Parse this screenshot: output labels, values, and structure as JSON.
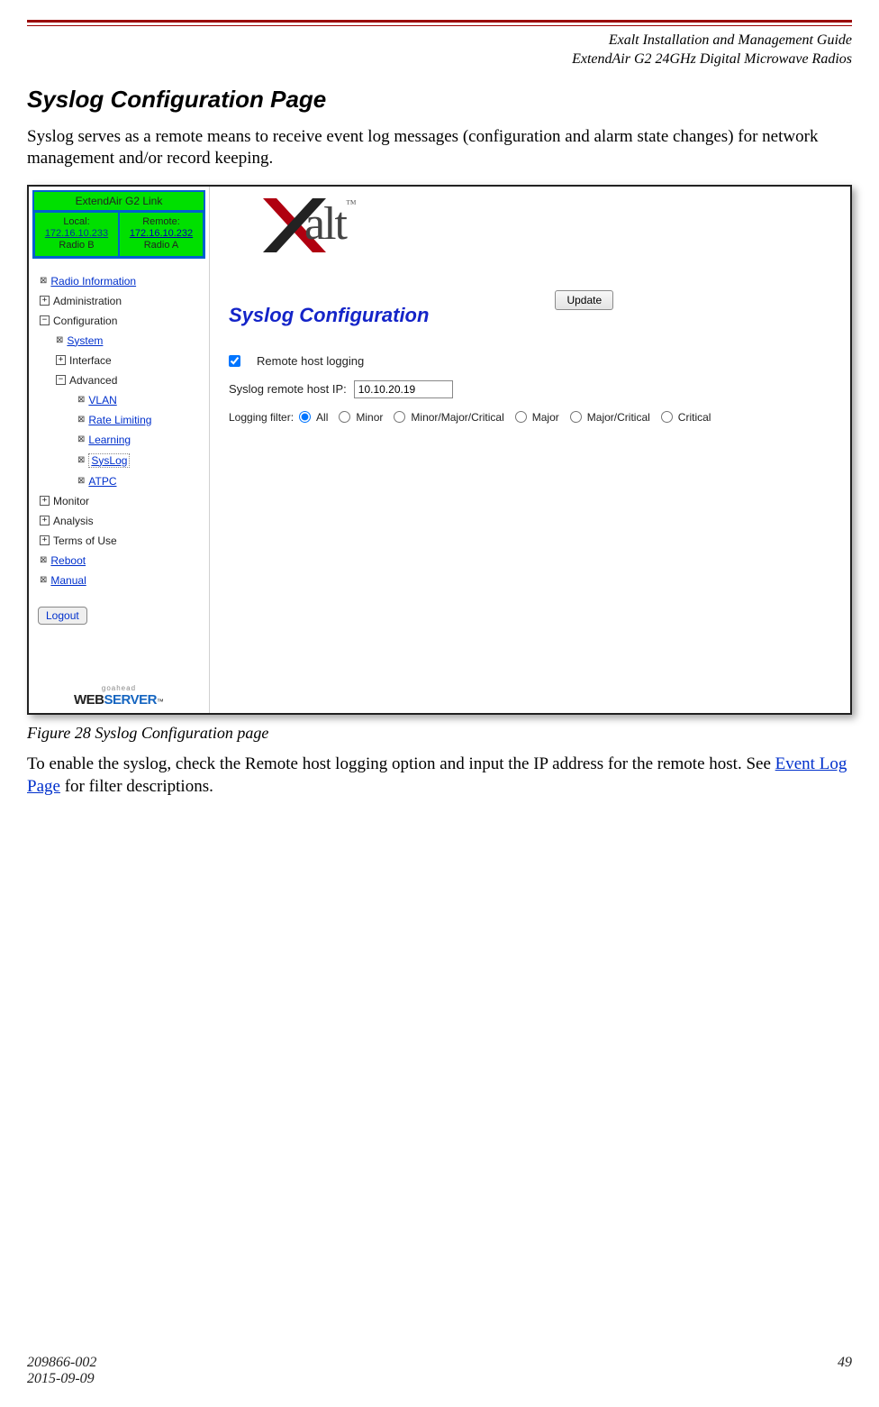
{
  "doc": {
    "header_line1": "Exalt Installation and Management Guide",
    "header_line2": "ExtendAir G2 24GHz Digital Microwave Radios",
    "section_title": "Syslog Configuration Page",
    "intro": "Syslog serves as a remote means to receive event log messages (configuration and alarm state changes) for network management and/or record keeping.",
    "fig_caption": "Figure 28   Syslog Configuration page",
    "para2_a": "To enable the syslog, check the Remote host logging option and input the IP address for the remote host. See ",
    "para2_link": "Event Log Page",
    "para2_b": " for filter descriptions.",
    "footer_docnum": "209866-002",
    "footer_date": "2015-09-09",
    "footer_pagenum": "49"
  },
  "sidebar": {
    "link_title": "ExtendAir G2 Link",
    "local": {
      "label": "Local:",
      "ip": "172.16.10.233",
      "radio": "Radio B"
    },
    "remote": {
      "label": "Remote:",
      "ip": "172.16.10.232",
      "radio": "Radio A"
    },
    "items": {
      "radio_info": "Radio Information",
      "administration": "Administration",
      "configuration": "Configuration",
      "system": "System",
      "interface": "Interface",
      "advanced": "Advanced",
      "vlan": "VLAN",
      "ratelimiting": "Rate Limiting",
      "learning": "Learning",
      "syslog": "SysLog",
      "atpc": "ATPC",
      "monitor": "Monitor",
      "analysis": "Analysis",
      "terms": "Terms of Use",
      "reboot": "Reboot",
      "manual": "Manual"
    },
    "logout": "Logout",
    "webserver_small": "goahead",
    "webserver_a": "WEB",
    "webserver_b": "SERVER"
  },
  "main": {
    "logo_text": "alt",
    "title": "Syslog Configuration",
    "update": "Update",
    "chk_label": "Remote host logging",
    "ip_label": "Syslog remote host IP:",
    "ip_value": "10.10.20.19",
    "filter_label": "Logging filter:",
    "filters": {
      "all": "All",
      "minor": "Minor",
      "mmc": "Minor/Major/Critical",
      "major": "Major",
      "mc": "Major/Critical",
      "critical": "Critical"
    }
  }
}
